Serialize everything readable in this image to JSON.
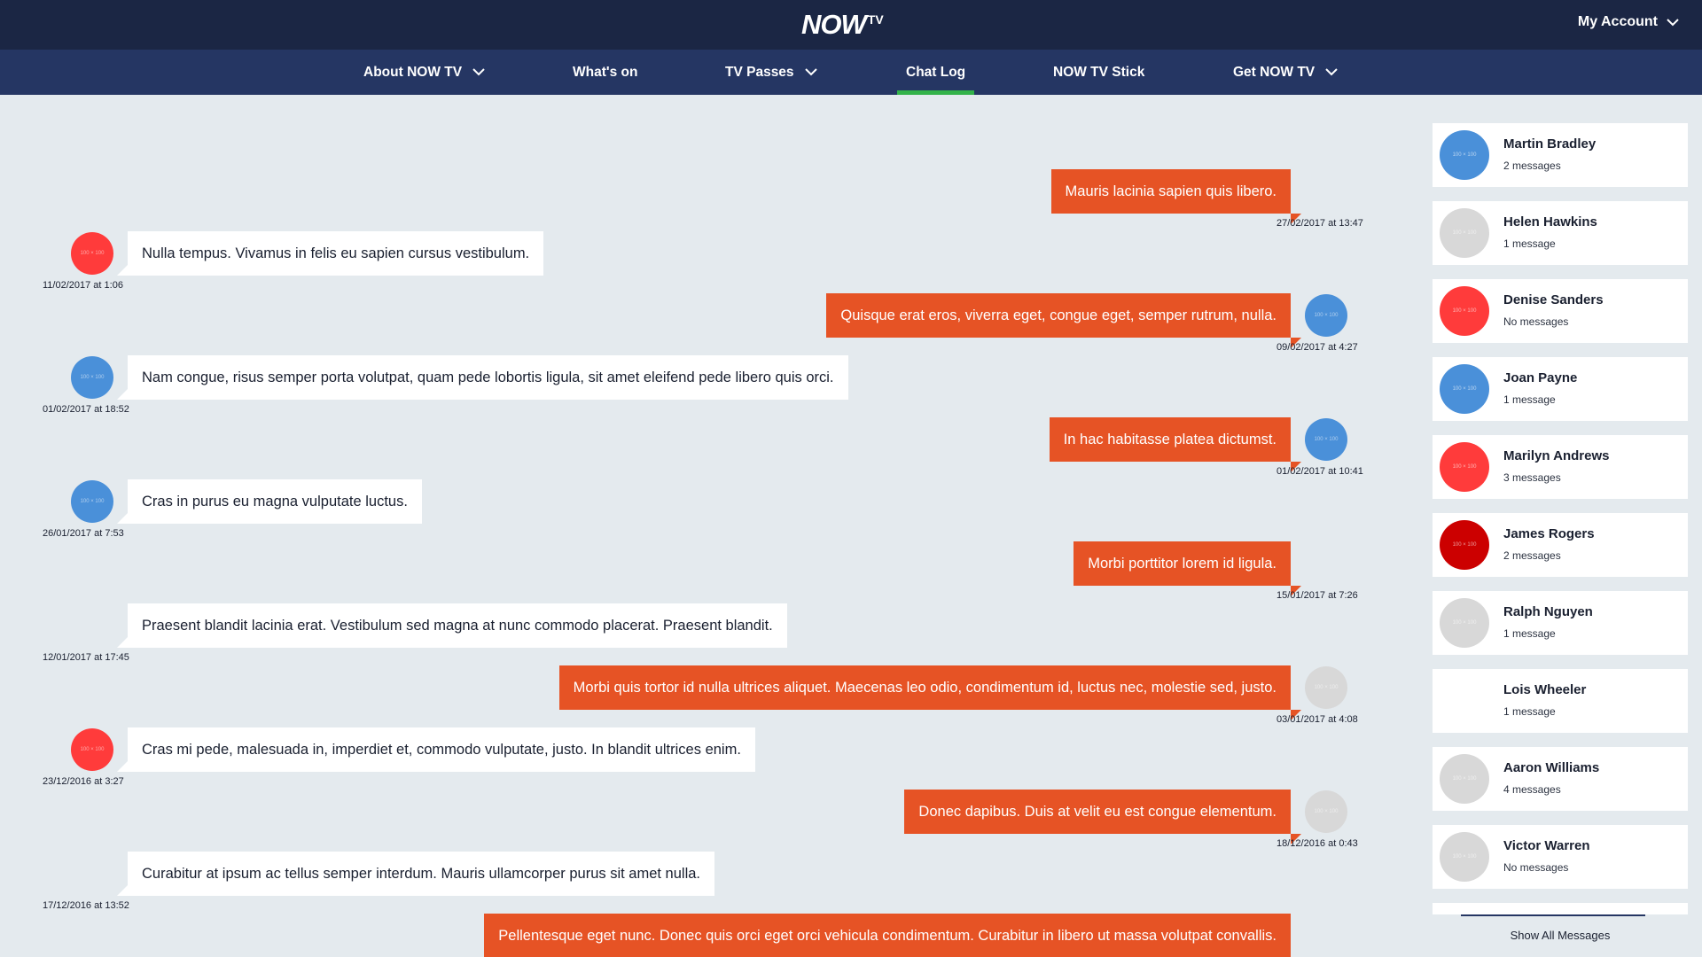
{
  "header": {
    "logo_text": "NOW",
    "logo_suffix": "TV",
    "account_label": "My Account"
  },
  "nav": {
    "items": [
      {
        "label": "About NOW TV",
        "has_dropdown": true,
        "active": false
      },
      {
        "label": "What's on",
        "has_dropdown": false,
        "active": false
      },
      {
        "label": "TV Passes",
        "has_dropdown": true,
        "active": false
      },
      {
        "label": "Chat Log",
        "has_dropdown": false,
        "active": true
      },
      {
        "label": "NOW TV Stick",
        "has_dropdown": false,
        "active": false
      },
      {
        "label": "Get NOW TV",
        "has_dropdown": true,
        "active": false
      }
    ],
    "active_color": "#33b34a"
  },
  "chat": {
    "placeholder_avatar_text": "100 × 100",
    "messages": [
      {
        "direction": "out",
        "text": "Mauris lacinia sapien quis libero.",
        "timestamp": "27/02/2017 at 13:47",
        "avatar_color": null
      },
      {
        "direction": "in",
        "text": "Nulla tempus. Vivamus in felis eu sapien cursus vestibulum.",
        "timestamp": "11/02/2017 at 1:06",
        "avatar_color": "#ff3b3b"
      },
      {
        "direction": "out",
        "text": "Quisque erat eros, viverra eget, congue eget, semper rutrum, nulla.",
        "timestamp": "09/02/2017 at 4:27",
        "avatar_color": "#4a90d9"
      },
      {
        "direction": "in",
        "text": "Nam congue, risus semper porta volutpat, quam pede lobortis ligula, sit amet eleifend pede libero quis orci.",
        "timestamp": "01/02/2017 at 18:52",
        "avatar_color": "#4a90d9"
      },
      {
        "direction": "out",
        "text": "In hac habitasse platea dictumst.",
        "timestamp": "01/02/2017 at 10:41",
        "avatar_color": "#4a90d9"
      },
      {
        "direction": "in",
        "text": "Cras in purus eu magna vulputate luctus.",
        "timestamp": "26/01/2017 at 7:53",
        "avatar_color": "#4a90d9"
      },
      {
        "direction": "out",
        "text": "Morbi porttitor lorem id ligula.",
        "timestamp": "15/01/2017 at 7:26",
        "avatar_color": null
      },
      {
        "direction": "in",
        "text": "Praesent blandit lacinia erat. Vestibulum sed magna at nunc commodo placerat. Praesent blandit.",
        "timestamp": "12/01/2017 at 17:45",
        "avatar_color": null
      },
      {
        "direction": "out",
        "text": "Morbi quis tortor id nulla ultrices aliquet. Maecenas leo odio, condimentum id, luctus nec, molestie sed, justo.",
        "timestamp": "03/01/2017 at 4:08",
        "avatar_color": "#d8d8d8"
      },
      {
        "direction": "in",
        "text": "Cras mi pede, malesuada in, imperdiet et, commodo vulputate, justo. In blandit ultrices enim.",
        "timestamp": "23/12/2016 at 3:27",
        "avatar_color": "#ff3b3b"
      },
      {
        "direction": "out",
        "text": "Donec dapibus. Duis at velit eu est congue elementum.",
        "timestamp": "18/12/2016 at 0:43",
        "avatar_color": "#d8d8d8"
      },
      {
        "direction": "in",
        "text": "Curabitur at ipsum ac tellus semper interdum. Mauris ullamcorper purus sit amet nulla.",
        "timestamp": "17/12/2016 at 13:52",
        "avatar_color": null
      },
      {
        "direction": "out",
        "text": "Pellentesque eget nunc. Donec quis orci eget orci vehicula condimentum. Curabitur in libero ut massa volutpat convallis.",
        "timestamp": "",
        "avatar_color": null
      }
    ]
  },
  "sidebar": {
    "contacts": [
      {
        "name": "Martin Bradley",
        "count": "2 messages",
        "avatar_color": "#4a90d9"
      },
      {
        "name": "Helen Hawkins",
        "count": "1 message",
        "avatar_color": "#d8d8d8"
      },
      {
        "name": "Denise Sanders",
        "count": "No messages",
        "avatar_color": "#ff3b3b"
      },
      {
        "name": "Joan Payne",
        "count": "1 message",
        "avatar_color": "#4a90d9"
      },
      {
        "name": "Marilyn Andrews",
        "count": "3 messages",
        "avatar_color": "#ff3b3b"
      },
      {
        "name": "James Rogers",
        "count": "2 messages",
        "avatar_color": "#cc0000"
      },
      {
        "name": "Ralph Nguyen",
        "count": "1 message",
        "avatar_color": "#d8d8d8"
      },
      {
        "name": "Lois Wheeler",
        "count": "1 message",
        "avatar_color": null
      },
      {
        "name": "Aaron Williams",
        "count": "4 messages",
        "avatar_color": "#d8d8d8"
      },
      {
        "name": "Victor Warren",
        "count": "No messages",
        "avatar_color": "#d8d8d8"
      }
    ],
    "show_all_label": "Show All Messages"
  },
  "colors": {
    "header_bg": "#1b2644",
    "nav_bg": "#253663",
    "outgoing_bubble": "#e65325",
    "incoming_bubble": "#ffffff",
    "page_bg": "#e4eaee"
  }
}
